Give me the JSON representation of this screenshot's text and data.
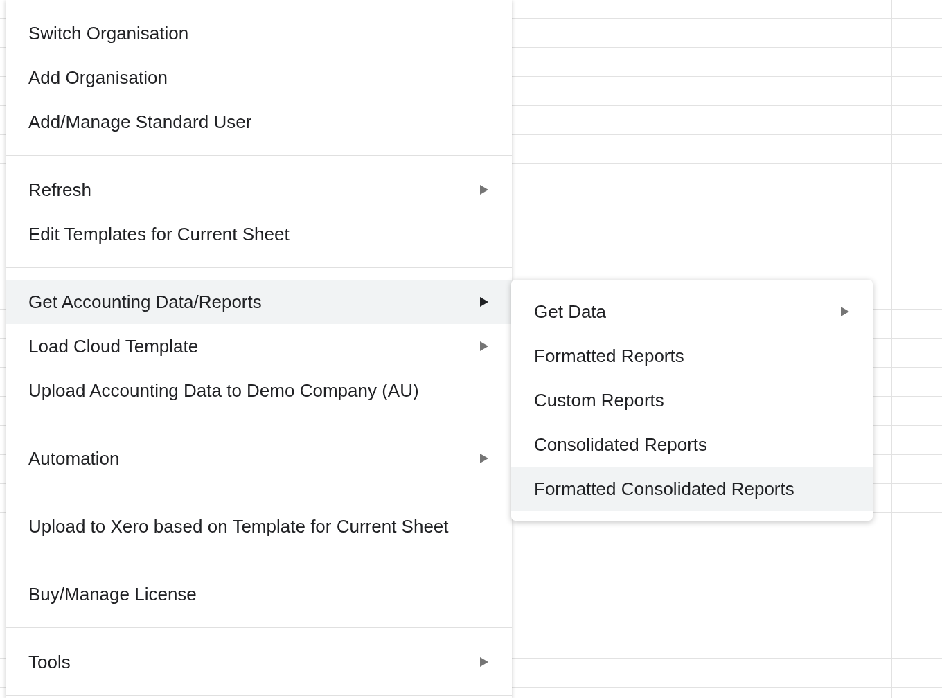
{
  "main_menu": {
    "groups": [
      [
        {
          "label": "Switch Organisation",
          "has_submenu": false,
          "selected": false
        },
        {
          "label": "Add Organisation",
          "has_submenu": false,
          "selected": false
        },
        {
          "label": "Add/Manage Standard User",
          "has_submenu": false,
          "selected": false
        }
      ],
      [
        {
          "label": "Refresh",
          "has_submenu": true,
          "selected": false
        },
        {
          "label": "Edit Templates for Current Sheet",
          "has_submenu": false,
          "selected": false
        }
      ],
      [
        {
          "label": "Get Accounting Data/Reports",
          "has_submenu": true,
          "selected": true
        },
        {
          "label": "Load Cloud Template",
          "has_submenu": true,
          "selected": false
        },
        {
          "label": "Upload Accounting Data to Demo Company (AU)",
          "has_submenu": false,
          "selected": false
        }
      ],
      [
        {
          "label": "Automation",
          "has_submenu": true,
          "selected": false
        }
      ],
      [
        {
          "label": "Upload to Xero based on Template for Current Sheet",
          "has_submenu": false,
          "selected": false
        }
      ],
      [
        {
          "label": "Buy/Manage License",
          "has_submenu": false,
          "selected": false
        }
      ],
      [
        {
          "label": "Tools",
          "has_submenu": true,
          "selected": false
        }
      ]
    ]
  },
  "submenu": {
    "items": [
      {
        "label": "Get Data",
        "has_submenu": true,
        "selected": false
      },
      {
        "label": "Formatted Reports",
        "has_submenu": false,
        "selected": false
      },
      {
        "label": "Custom Reports",
        "has_submenu": false,
        "selected": false
      },
      {
        "label": "Consolidated Reports",
        "has_submenu": false,
        "selected": false
      },
      {
        "label": "Formatted Consolidated Reports",
        "has_submenu": false,
        "selected": true
      }
    ]
  }
}
